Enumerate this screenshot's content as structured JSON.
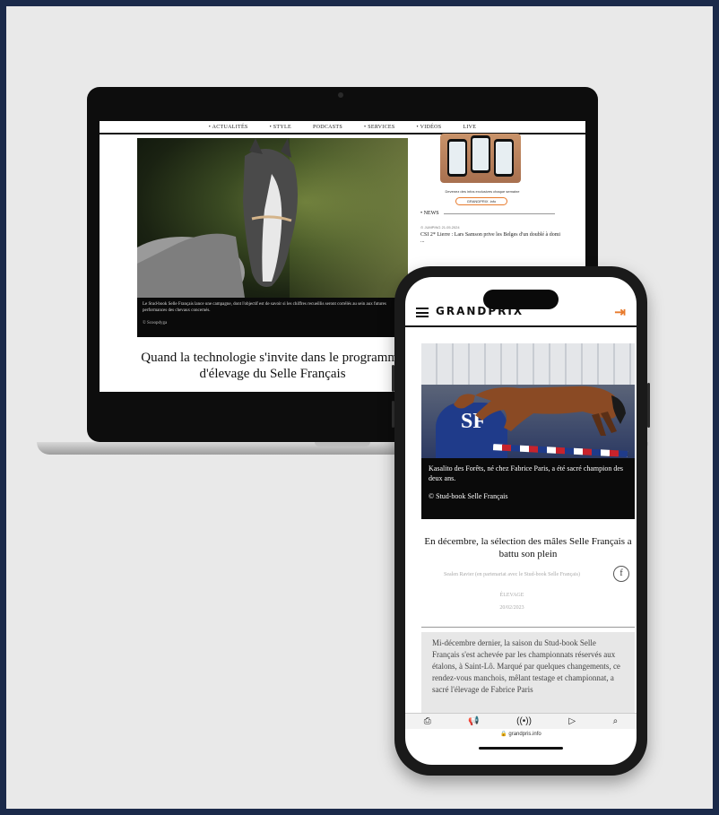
{
  "laptop": {
    "nav": [
      "• ACTUALITÉS",
      "• STYLE",
      "PODCASTS",
      "• SERVICES",
      "• VIDÉOS",
      "LIVE"
    ],
    "hero_caption": "Le Stud-book Selle Français lance une campagne, dont l'objectif est de savoir si les chiffres recueillis seront corrélés au sein aux futures performances des chevaux concernés.",
    "hero_credit": "© Scoopdyga",
    "headline": "Quand la technologie s'invite dans le programme d'élevage du Selle Français",
    "ad_text": "Devenez des infos exclusives chaque semaine",
    "ad_logo": "GRANDPRIX .info",
    "news_label": "• NEWS",
    "news_meta": "⊙ JUMPING   21.05.2024",
    "news_item": "CSI 2* Lierre : Lars Samson prive les Belges d'un doublé à domi ..."
  },
  "phone": {
    "brand": "GRANDPRIX",
    "caption": "Kasalito des Forêts, né chez Fabrice Paris, a été sacré champion des deux ans.",
    "credit": "© Stud-book Selle Français",
    "title": "En décembre, la sélection des mâles Selle Français a battu son plein",
    "share_icon_label": "f",
    "byline": "Sealen Ravier (en partenariat avec le Stud-book Selle Français)",
    "category": "ÉLEVAGE",
    "date": "20/02/2023",
    "body": "Mi-décembre dernier, la saison du Stud-book Selle Français s'est achevée par les championnats réservés aux étalons, à Saint-Lô. Marqué par quelques changements, ce rendez-vous manchois, mêlant testage et championnat, a sacré l'élevage de Fabrice Paris",
    "bottom_icons": [
      "⎙",
      "📢",
      "((•))",
      "▷",
      "⌕"
    ],
    "url": "🔒 grandpris.info"
  }
}
